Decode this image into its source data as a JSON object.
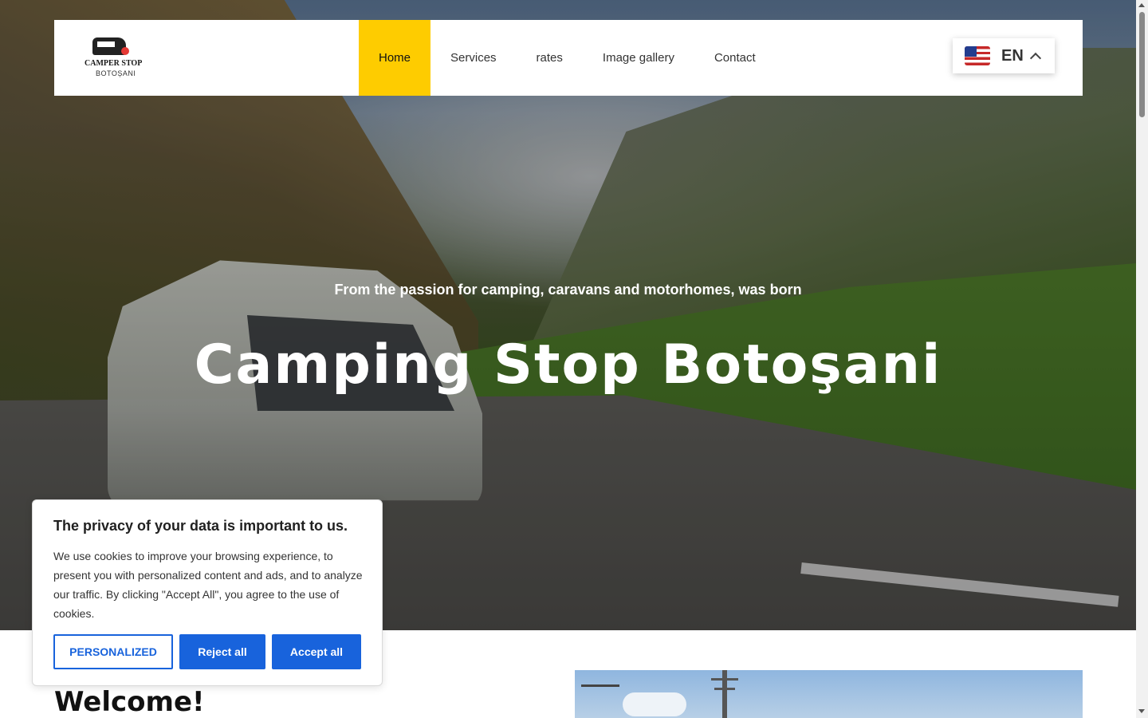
{
  "brand": {
    "logo_text": "CAMPER STOP",
    "logo_subtext": "BOTOȘANI"
  },
  "nav": {
    "items": [
      {
        "label": "Home"
      },
      {
        "label": "Services"
      },
      {
        "label": "rates"
      },
      {
        "label": "Image gallery"
      },
      {
        "label": "Contact"
      }
    ],
    "active": "Home",
    "active_color": "#fecc00"
  },
  "language": {
    "code": "EN",
    "flag_icon": "us-flag-icon",
    "chevron_icon": "chevron-up-icon"
  },
  "hero": {
    "subtitle": "From the passion for camping, caravans and motorhomes, was born",
    "title": "Camping Stop Botoşani"
  },
  "welcome": {
    "heading": "Welcome!"
  },
  "cookie": {
    "title": "The privacy of your data is important to us.",
    "text": "We use cookies to improve your browsing experience, to present you with personalized content and ads, and to analyze our traffic. By clicking \"Accept All\", you agree to the use of cookies.",
    "personalized_label": "PERSONALIZED",
    "reject_label": "Reject all",
    "accept_label": "Accept all",
    "accent_color": "#1863dc"
  }
}
